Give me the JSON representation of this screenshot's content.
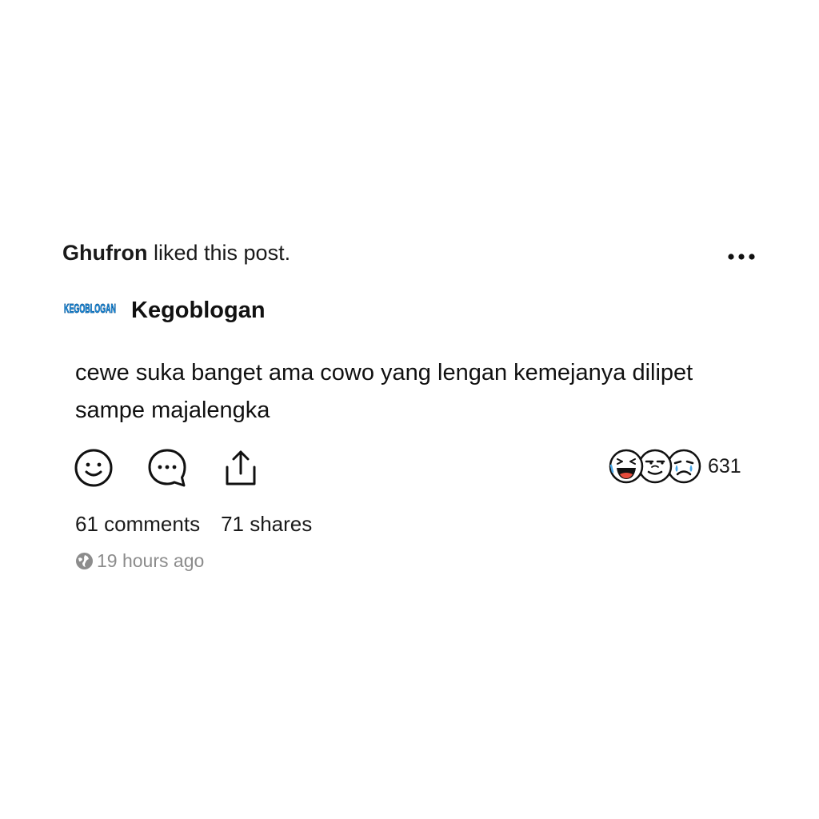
{
  "activity": {
    "actor": "Ghufron",
    "action_text": " liked this post."
  },
  "post": {
    "page_logo_text": "KEGOBLOGAN",
    "page_name": "Kegoblogan",
    "text": "cewe suka banget ama cowo yang lengan kemejanya dilipet sampe majalengka",
    "reaction_count": "631",
    "comments_label": "61 comments",
    "shares_label": "71 shares",
    "time_ago": "19 hours ago"
  },
  "icons": {
    "more": "more-dots-icon",
    "react": "smiley-icon",
    "comment": "comment-bubble-icon",
    "share": "share-upload-icon",
    "reactions": [
      "laughing-face-icon",
      "smirk-face-icon",
      "crying-face-icon"
    ],
    "globe": "globe-icon"
  },
  "colors": {
    "text": "#111111",
    "muted": "#8c8c8c",
    "logo_blue": "#1d9bf0",
    "tear_blue": "#4aa8e8",
    "tongue_red": "#e74c3c"
  }
}
